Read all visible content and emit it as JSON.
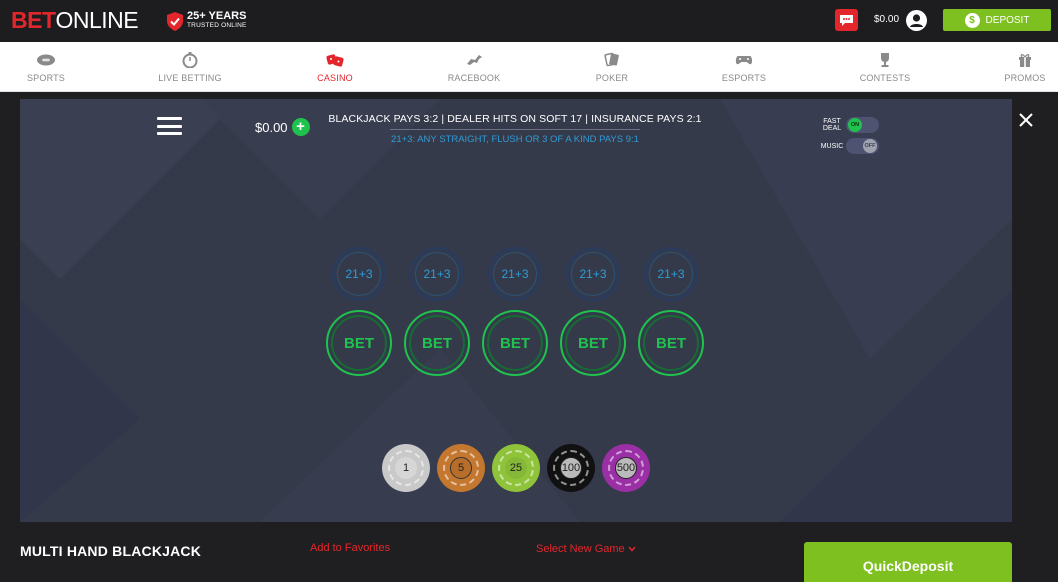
{
  "header": {
    "logo_bet": "BET",
    "logo_online": "ONLINE",
    "years_big": "25+ YEARS",
    "years_small": "TRUSTED ONLINE",
    "balance": "$0.00",
    "deposit_label": "DEPOSIT",
    "deposit_icon": "$"
  },
  "nav": {
    "items": [
      {
        "label": "SPORTS",
        "icon": "football-icon"
      },
      {
        "label": "LIVE BETTING",
        "icon": "stopwatch-icon"
      },
      {
        "label": "CASINO",
        "icon": "dice-icon",
        "active": true
      },
      {
        "label": "RACEBOOK",
        "icon": "horse-icon"
      },
      {
        "label": "POKER",
        "icon": "cards-icon"
      },
      {
        "label": "ESPORTS",
        "icon": "gamepad-icon"
      },
      {
        "label": "CONTESTS",
        "icon": "trophy-icon"
      },
      {
        "label": "PROMOS",
        "icon": "gift-icon"
      }
    ]
  },
  "game": {
    "balance": "$0.00",
    "plus": "+",
    "rule_line_1": "BLACKJACK PAYS 3:2  |  DEALER HITS ON SOFT 17  |  INSURANCE PAYS 2:1",
    "rule_line_2": "21+3: ANY STRAIGHT, FLUSH OR 3 OF A KIND PAYS 9:1",
    "fast_deal_label": "FAST DEAL",
    "fast_deal_state": "ON",
    "music_label": "MUSIC",
    "music_state": "OFF",
    "side_bets": [
      "21+3",
      "21+3",
      "21+3",
      "21+3",
      "21+3"
    ],
    "bet_spots": [
      "BET",
      "BET",
      "BET",
      "BET",
      "BET"
    ],
    "chips": [
      {
        "value": "1",
        "color": "#c9c9c9"
      },
      {
        "value": "5",
        "color": "#c4772e"
      },
      {
        "value": "25",
        "color": "#8fc43a"
      },
      {
        "value": "100",
        "color": "#111111"
      },
      {
        "value": "500",
        "color": "#9b2fa6"
      }
    ]
  },
  "footer": {
    "game_title": "MULTI HAND BLACKJACK",
    "favorites": "Add to Favorites",
    "select_game": "Select New Game",
    "quick_deposit": "QuickDeposit"
  },
  "colors": {
    "brand_red": "#e3262b",
    "deposit_green": "#7dc01f",
    "table_bg": "#353a4b",
    "bet_green": "#1fc24c",
    "side_bet_blue": "#2f9bd6"
  }
}
